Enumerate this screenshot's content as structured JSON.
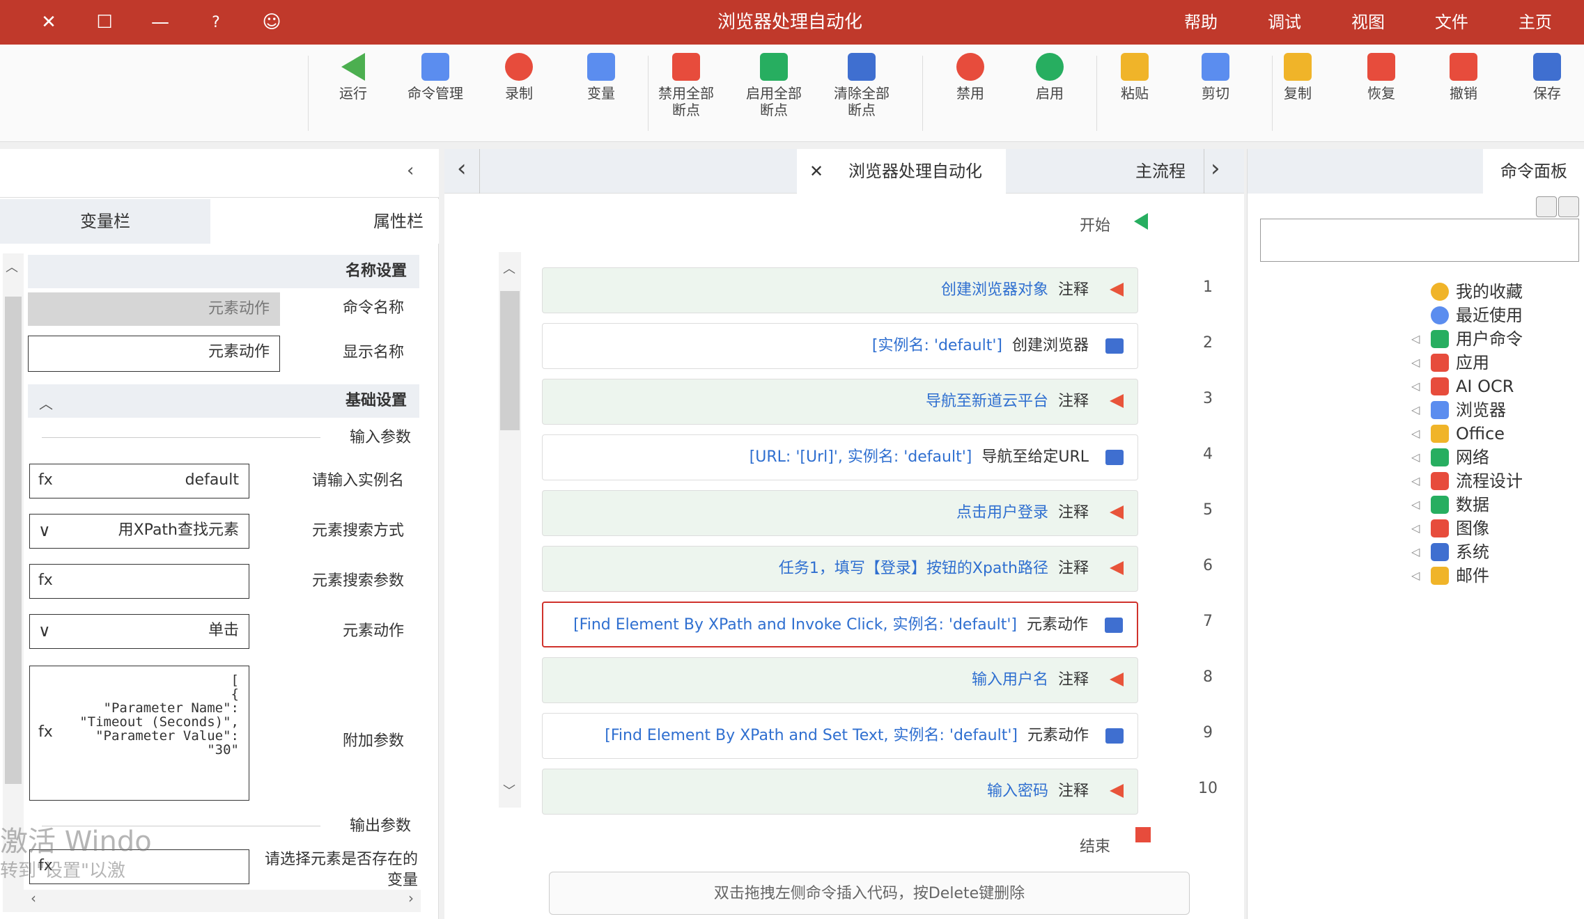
{
  "titlebar": {
    "title": "浏览器处理自动化",
    "controls": {
      "close": "✕",
      "maximize": "☐",
      "minimize": "—",
      "help": "?",
      "account": "☺"
    },
    "menu": [
      "帮助",
      "调试",
      "视图",
      "文件",
      "主页"
    ]
  },
  "toolbar": {
    "items": [
      {
        "label": "运行",
        "icon": "run-icon",
        "color": "#4caf50"
      },
      {
        "label": "命令管理",
        "icon": "grid-icon",
        "color": "#5b8def"
      },
      {
        "label": "录制",
        "icon": "record-icon",
        "color": "#e74c3c"
      },
      {
        "label": "变量",
        "icon": "grid-icon",
        "color": "#5b8def"
      },
      {
        "label": "禁用全部断点",
        "icon": "tag-icon",
        "color": "#e74c3c"
      },
      {
        "label": "启用全部断点",
        "icon": "tag-icon",
        "color": "#27ae60"
      },
      {
        "label": "清除全部断点",
        "icon": "clear-icon",
        "color": "#3f6fd0"
      },
      {
        "label": "禁用",
        "icon": "disable-icon",
        "color": "#e74c3c"
      },
      {
        "label": "启用",
        "icon": "check-icon",
        "color": "#27ae60"
      },
      {
        "label": "粘贴",
        "icon": "paste-icon",
        "color": "#f0b429"
      },
      {
        "label": "剪切",
        "icon": "scissors-icon",
        "color": "#5b8def"
      },
      {
        "label": "复制",
        "icon": "copy-icon",
        "color": "#f0b429"
      },
      {
        "label": "恢复",
        "icon": "undo-icon",
        "color": "#e74c3c"
      },
      {
        "label": "撤销",
        "icon": "redo-icon",
        "color": "#e74c3c"
      },
      {
        "label": "保存",
        "icon": "save-icon",
        "color": "#3f6fd0"
      }
    ]
  },
  "left_panel": {
    "tabs": [
      "变量栏",
      "属性栏"
    ],
    "name_section": "名称设置",
    "command_name_label": "命令名称",
    "command_name_value": "元素动作",
    "display_name_label": "显示名称",
    "display_name_value": "元素动作",
    "basic_section": "基础设置",
    "input_params": "输入参数",
    "instance_label": "请输入实例名",
    "instance_value": "default",
    "search_method_label": "元素搜索方式",
    "search_method_value": "用XPath查找元素",
    "search_param_label": "元素搜索参数",
    "search_param_value": "",
    "action_label": "元素动作",
    "action_value": "单击",
    "extra_label": "附加参数",
    "extra_value_lines": [
      "[",
      "  {",
      "    \"Parameter Name\":",
      "\"Timeout (Seconds)\",",
      "    \"Parameter Value\":",
      "\"30\"",
      ""
    ],
    "output_params": "输出参数",
    "exists_label": "请选择元素是否存在的变量",
    "exists_value": "",
    "watermark_1": "激活 Windo",
    "watermark_2": "转到\"设置\"以激",
    "fx": "fx"
  },
  "center": {
    "tabs": [
      {
        "label": "主流程"
      },
      {
        "label": "浏览器处理自动化",
        "active": true
      }
    ],
    "start_label": "开始",
    "end_label": "结束",
    "rows": [
      {
        "num": "1",
        "kind": "注释",
        "text": "创建浏览器对象",
        "comment": true
      },
      {
        "num": "2",
        "kind": "创建浏览器",
        "text": "[实例名: 'default']",
        "comment": false
      },
      {
        "num": "3",
        "kind": "注释",
        "text": "导航至新道云平台",
        "comment": true
      },
      {
        "num": "4",
        "kind": "导航至给定URL",
        "text": "[URL: '[Url]', 实例名: 'default']",
        "comment": false
      },
      {
        "num": "5",
        "kind": "注释",
        "text": "点击用户登录",
        "comment": true
      },
      {
        "num": "6",
        "kind": "注释",
        "text": "任务1，填写【登录】按钮的Xpath路径",
        "comment": true
      },
      {
        "num": "7",
        "kind": "元素动作",
        "text": "[Find Element By XPath and Invoke Click, 实例名: 'default']",
        "comment": false,
        "selected": true
      },
      {
        "num": "8",
        "kind": "注释",
        "text": "输入用户名",
        "comment": true
      },
      {
        "num": "9",
        "kind": "元素动作",
        "text": "[Find Element By XPath and Set Text, 实例名: 'default']",
        "comment": false
      },
      {
        "num": "10",
        "kind": "注释",
        "text": "输入密码",
        "comment": true
      }
    ],
    "hint": "双击拖拽左侧命令插入代码，按Delete键删除"
  },
  "right_panel": {
    "title": "命令面板",
    "search_placeholder": "",
    "tree": [
      {
        "label": "我的收藏",
        "icon": "star-icon",
        "color": "#f0b429"
      },
      {
        "label": "最近使用",
        "icon": "clock-icon",
        "color": "#5b8def"
      },
      {
        "label": "用户命令",
        "icon": "terminal-icon",
        "color": "#27ae60"
      },
      {
        "label": "应用",
        "icon": "apps-icon",
        "color": "#e74c3c"
      },
      {
        "label": "AI OCR",
        "icon": "apps-icon",
        "color": "#e74c3c"
      },
      {
        "label": "浏览器",
        "icon": "browser-icon",
        "color": "#5b8def"
      },
      {
        "label": "Office",
        "icon": "office-icon",
        "color": "#f0b429"
      },
      {
        "label": "网络",
        "icon": "network-icon",
        "color": "#27ae60"
      },
      {
        "label": "流程设计",
        "icon": "flow-icon",
        "color": "#e74c3c"
      },
      {
        "label": "数据",
        "icon": "data-icon",
        "color": "#27ae60"
      },
      {
        "label": "图像",
        "icon": "image-icon",
        "color": "#e74c3c"
      },
      {
        "label": "系统",
        "icon": "system-icon",
        "color": "#3f6fd0"
      },
      {
        "label": "邮件",
        "icon": "mail-icon",
        "color": "#f0b429"
      }
    ]
  }
}
